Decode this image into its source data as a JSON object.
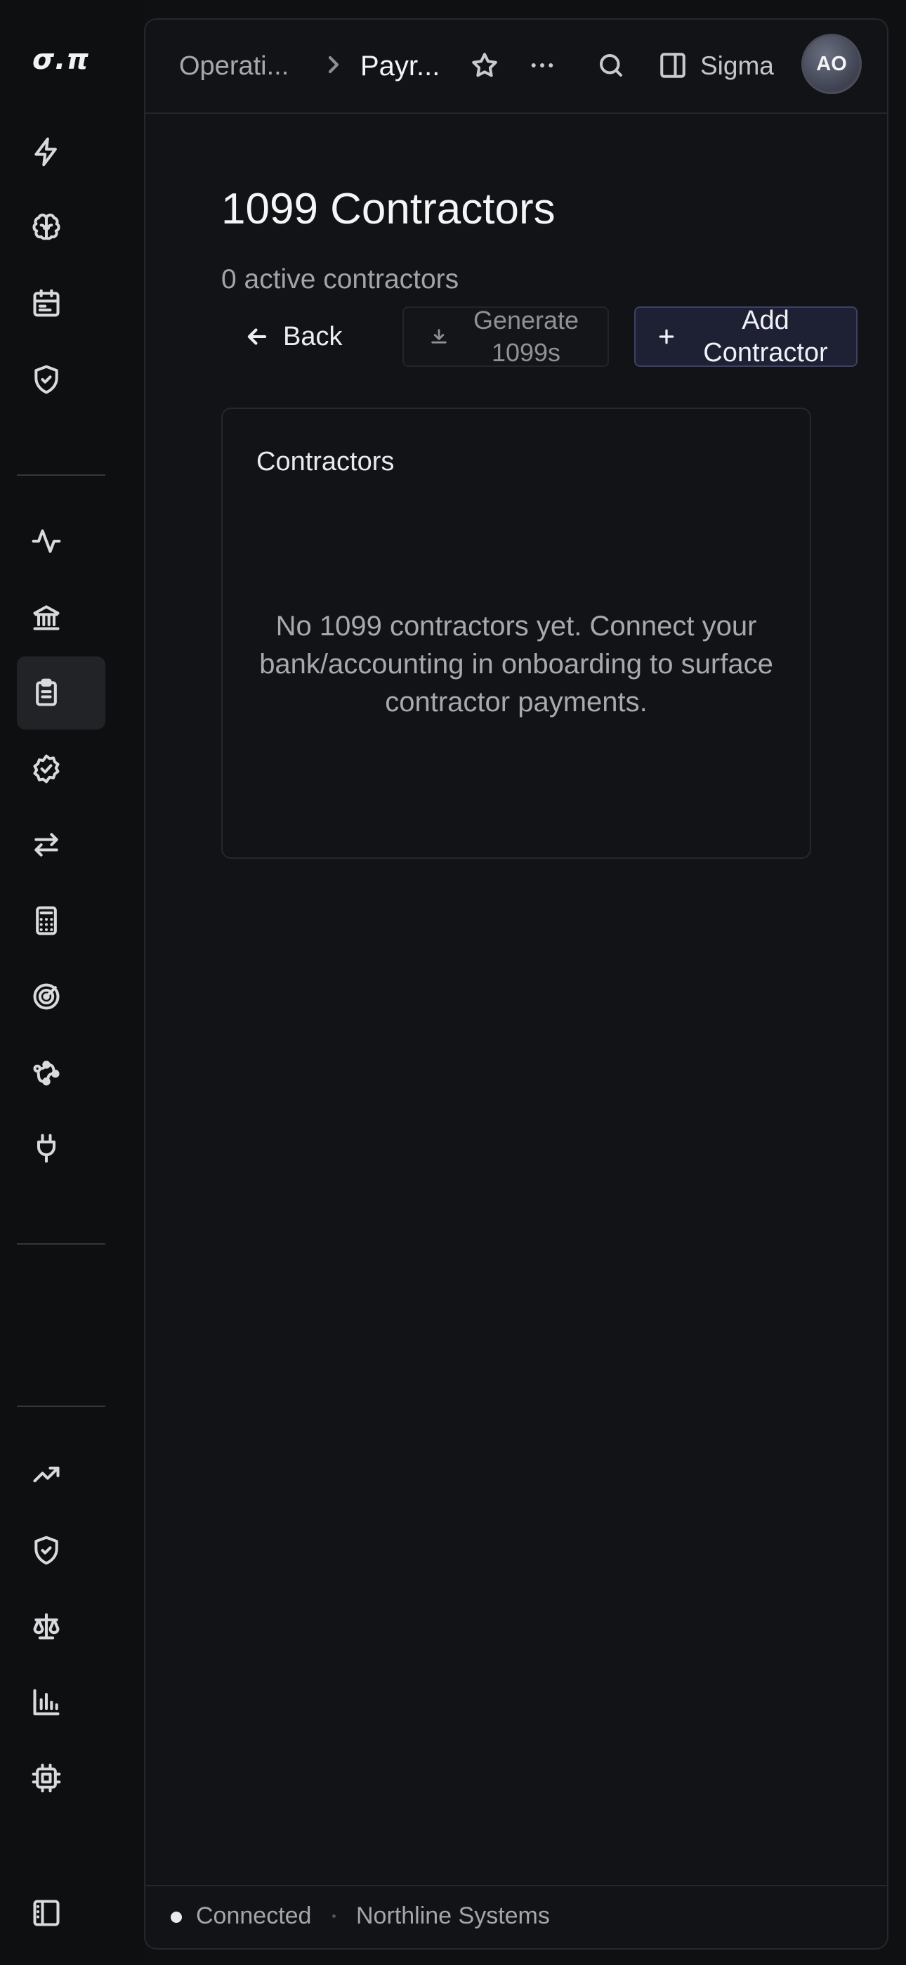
{
  "app": {
    "logo": "σ.π"
  },
  "sidebar": {
    "items": [
      {
        "icon": "bolt-icon"
      },
      {
        "icon": "brain-icon"
      },
      {
        "icon": "calendar-icon"
      },
      {
        "icon": "shield-check-icon"
      },
      {
        "icon": "activity-icon"
      },
      {
        "icon": "bank-icon"
      },
      {
        "icon": "clipboard-list-icon",
        "active": true
      },
      {
        "icon": "badge-check-icon"
      },
      {
        "icon": "transfer-icon"
      },
      {
        "icon": "calculator-icon"
      },
      {
        "icon": "radar-icon"
      },
      {
        "icon": "workflow-icon"
      },
      {
        "icon": "plug-icon"
      },
      {
        "icon": "trending-up-icon"
      },
      {
        "icon": "shield-check-icon"
      },
      {
        "icon": "scale-icon"
      },
      {
        "icon": "bar-chart-icon"
      },
      {
        "icon": "cpu-icon"
      },
      {
        "icon": "panel-left-icon"
      }
    ]
  },
  "header": {
    "breadcrumb": [
      "Operati...",
      "Payr..."
    ],
    "workspace_label": "Sigma",
    "avatar_initials": "AO"
  },
  "page": {
    "title": "1099 Contractors",
    "subtitle": "0 active contractors"
  },
  "actions": {
    "back_label": "Back",
    "generate_label": "Generate 1099s",
    "add_label": "Add Contractor"
  },
  "card": {
    "title": "Contractors",
    "empty_message": "No 1099 contractors yet. Connect your bank/accounting in onboarding to surface contractor payments."
  },
  "status": {
    "connection": "Connected",
    "organization": "Northline Systems"
  }
}
